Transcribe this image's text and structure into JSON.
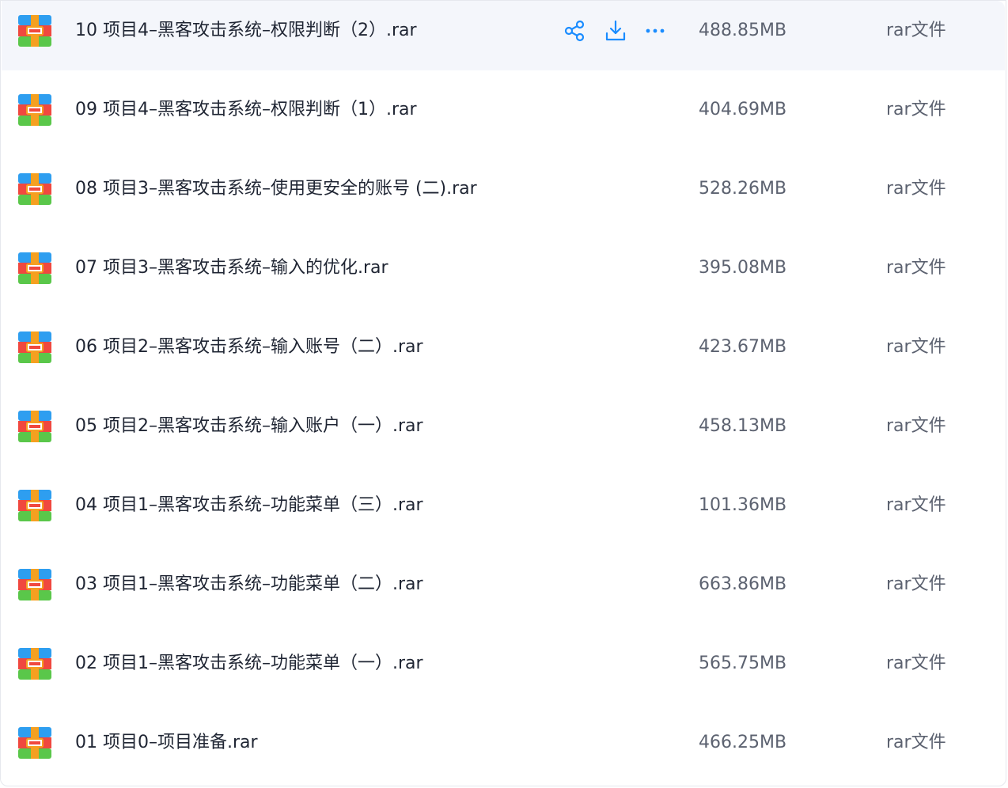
{
  "accent_color": "#1a8cff",
  "hover_row_index": 0,
  "row_actions": [
    {
      "name": "share",
      "icon": "share-icon"
    },
    {
      "name": "download",
      "icon": "download-icon"
    },
    {
      "name": "more",
      "icon": "more-icon"
    }
  ],
  "files": [
    {
      "name": "10 项目4–黑客攻击系统–权限判断（2）.rar",
      "size": "488.85MB",
      "type": "rar文件",
      "icon": "rar-archive-icon"
    },
    {
      "name": "09 项目4–黑客攻击系统–权限判断（1）.rar",
      "size": "404.69MB",
      "type": "rar文件",
      "icon": "rar-archive-icon"
    },
    {
      "name": "08 项目3–黑客攻击系统–使用更安全的账号 (二).rar",
      "size": "528.26MB",
      "type": "rar文件",
      "icon": "rar-archive-icon"
    },
    {
      "name": "07 项目3–黑客攻击系统–输入的优化.rar",
      "size": "395.08MB",
      "type": "rar文件",
      "icon": "rar-archive-icon"
    },
    {
      "name": "06 项目2–黑客攻击系统–输入账号（二）.rar",
      "size": "423.67MB",
      "type": "rar文件",
      "icon": "rar-archive-icon"
    },
    {
      "name": "05 项目2–黑客攻击系统–输入账户（一）.rar",
      "size": "458.13MB",
      "type": "rar文件",
      "icon": "rar-archive-icon"
    },
    {
      "name": "04 项目1–黑客攻击系统–功能菜单（三）.rar",
      "size": "101.36MB",
      "type": "rar文件",
      "icon": "rar-archive-icon"
    },
    {
      "name": "03 项目1–黑客攻击系统–功能菜单（二）.rar",
      "size": "663.86MB",
      "type": "rar文件",
      "icon": "rar-archive-icon"
    },
    {
      "name": "02 项目1–黑客攻击系统–功能菜单（一）.rar",
      "size": "565.75MB",
      "type": "rar文件",
      "icon": "rar-archive-icon"
    },
    {
      "name": "01 项目0–项目准备.rar",
      "size": "466.25MB",
      "type": "rar文件",
      "icon": "rar-archive-icon"
    }
  ]
}
